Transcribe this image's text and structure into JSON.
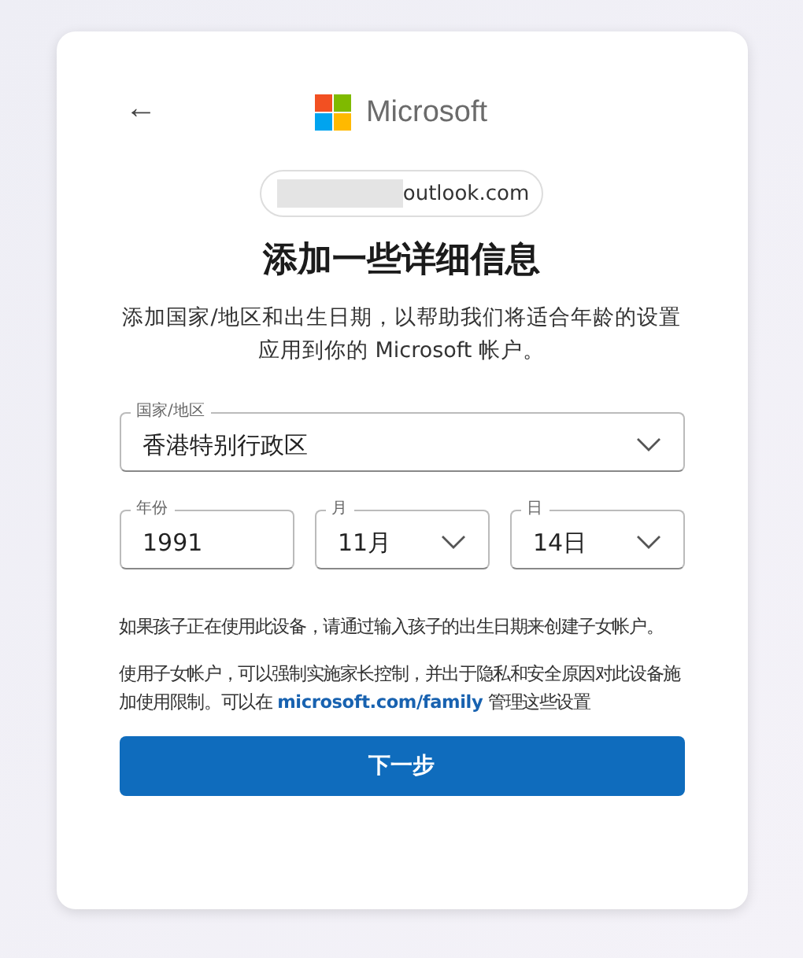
{
  "header": {
    "back": "←",
    "brand": "Microsoft"
  },
  "account": {
    "email": "outlook.com"
  },
  "title": "添加一些详细信息",
  "subtitle": "添加国家/地区和出生日期，以帮助我们将适合年龄的设置应用到你的 Microsoft 帐户。",
  "country": {
    "label": "国家/地区",
    "value": "香港特别行政区"
  },
  "birth": [
    {
      "kind": "input",
      "label": "年份",
      "value": "1991"
    },
    {
      "kind": "select",
      "label": "月",
      "value": "11月"
    },
    {
      "kind": "select",
      "label": "日",
      "value": "14日"
    }
  ],
  "notes": [
    {
      "before": "如果孩子正在使用此设备，请通过输入孩子的出生日期来创建子女帐户。"
    },
    {
      "before": "使用子女帐户，可以强制实施家长控制，并出于隐私和安全原因对此设备施加使用限制。可以在 ",
      "link": "microsoft.com/family",
      "after": " 管理这些设置"
    }
  ],
  "next_button": "下一步"
}
